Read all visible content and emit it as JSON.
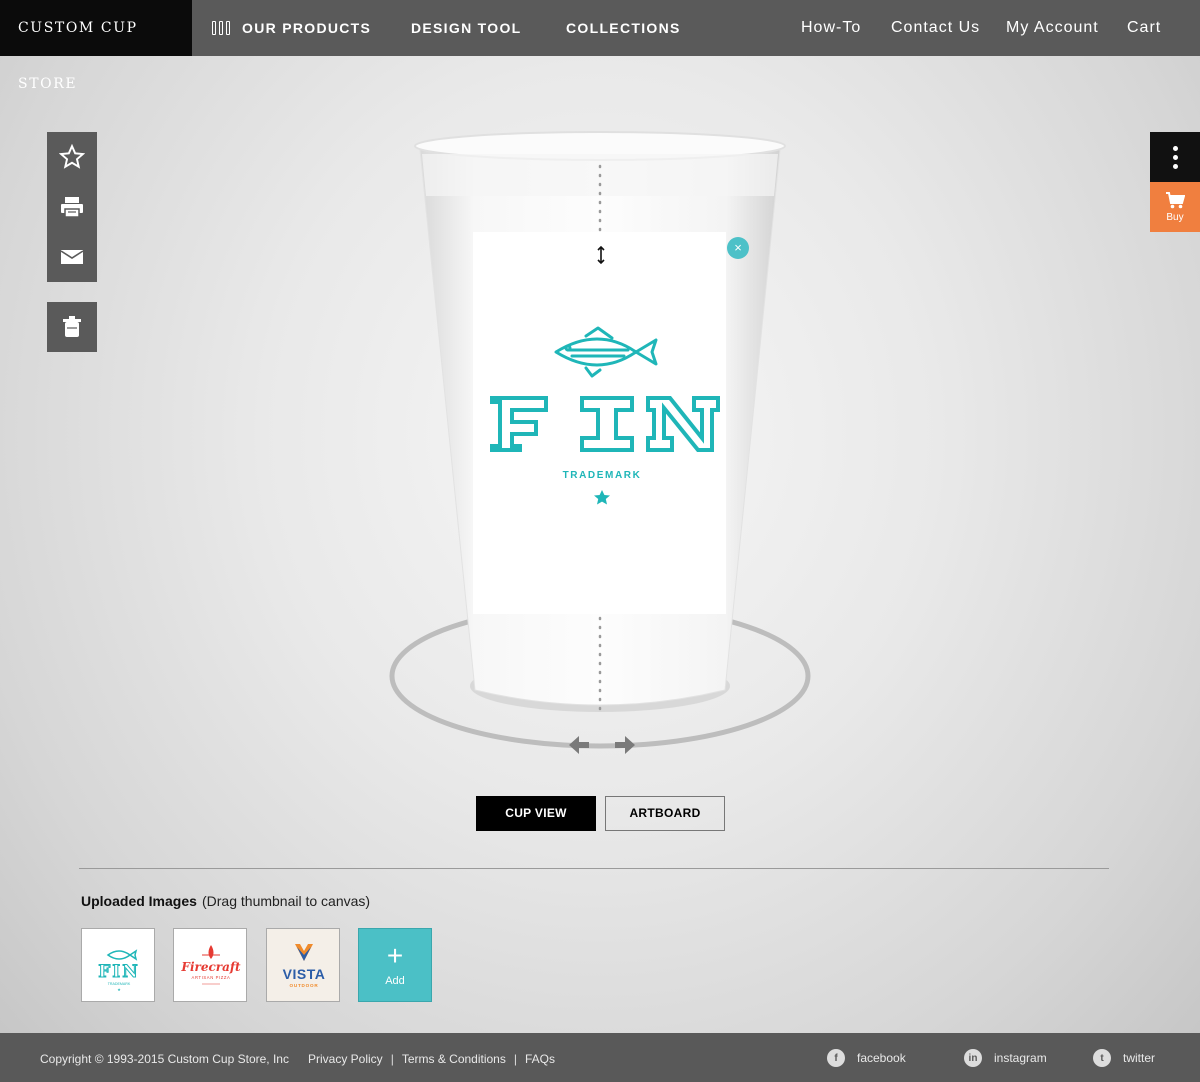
{
  "nav": {
    "brand": "CUSTOM CUP STORE",
    "main": [
      "OUR PRODUCTS",
      "DESIGN TOOL",
      "COLLECTIONS"
    ],
    "right": [
      "How-To",
      "Contact Us",
      "My Account",
      "Cart"
    ]
  },
  "tools": {
    "icons": [
      "star-icon",
      "print-icon",
      "mail-icon",
      "trash-icon"
    ]
  },
  "side": {
    "buy_label": "Buy"
  },
  "design": {
    "logo_text": "FIN",
    "logo_sub": "TRADEMARK",
    "close": "×"
  },
  "view": {
    "cup_view": "CUP VIEW",
    "artboard": "ARTBOARD"
  },
  "uploads": {
    "title": "Uploaded Images",
    "hint": "(Drag thumbnail to canvas)",
    "thumbs": [
      {
        "text": "FIN",
        "sub": "TRADEMARK"
      },
      {
        "text": "Firecraft",
        "sub": "ARTISAN PIZZA"
      },
      {
        "text": "VISTA",
        "sub": "OUTDOOR"
      }
    ],
    "add_label": "Add",
    "add_symbol": "+"
  },
  "footer": {
    "copyright": "Copyright © 1993-2015 Custom Cup Store, Inc",
    "links": [
      "Privacy Policy",
      "Terms & Conditions",
      "FAQs"
    ],
    "social": [
      {
        "label": "facebook",
        "icon": "f"
      },
      {
        "label": "instagram",
        "icon": "in"
      },
      {
        "label": "twitter",
        "icon": "t"
      }
    ]
  },
  "colors": {
    "accent": "#4bc0c6",
    "buy": "#f07f3f",
    "nav": "#5a5a5a",
    "brand_bg": "#0b0b0b"
  }
}
